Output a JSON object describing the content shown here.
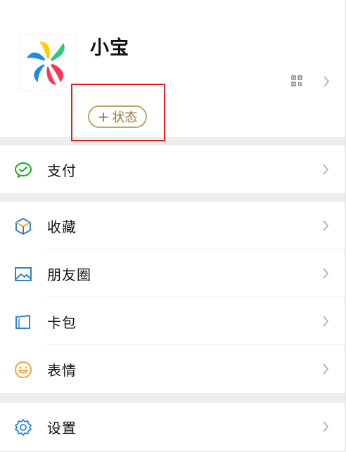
{
  "profile": {
    "nickname": "小宝",
    "status_button": {
      "plus": "+",
      "label": "状态"
    }
  },
  "menu": {
    "pay": {
      "label": "支付",
      "icon": "wechat-pay-icon"
    },
    "favorites": {
      "label": "收藏",
      "icon": "favorites-cube-icon"
    },
    "moments": {
      "label": "朋友圈",
      "icon": "moments-image-icon"
    },
    "cards": {
      "label": "卡包",
      "icon": "card-wallet-icon"
    },
    "stickers": {
      "label": "表情",
      "icon": "smile-face-icon"
    },
    "settings": {
      "label": "设置",
      "icon": "gear-icon"
    }
  },
  "colors": {
    "highlight": "#e02020",
    "status_gold": "#b9a96a",
    "pay_green": "#1aad19",
    "blue": "#2d84c8",
    "orange": "#f0a53a"
  }
}
